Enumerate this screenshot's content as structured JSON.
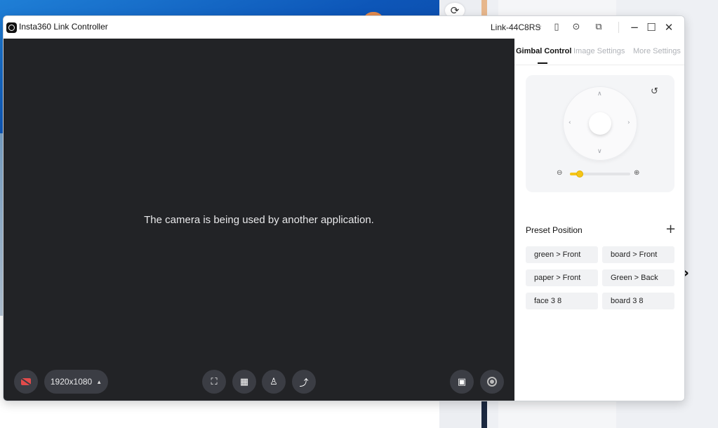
{
  "window": {
    "app_title": "Insta360 Link Controller",
    "device_name": "Link-44C8RS",
    "icons": [
      "device-icon",
      "more-icon",
      "pip-icon",
      "minimize-icon",
      "maximize-icon",
      "close-icon"
    ]
  },
  "preview": {
    "message": "The camera is being used by another application.",
    "resolution": "1920x1080",
    "bottom_icons": [
      "camera-off-icon",
      "tracking-icon",
      "whiteboard-icon",
      "desk-view-icon",
      "overhead-icon",
      "snapshot-icon",
      "record-icon"
    ]
  },
  "panel": {
    "tabs": [
      {
        "label": "Gimbal Control",
        "active": true
      },
      {
        "label": "Image Settings",
        "active": false
      },
      {
        "label": "More Settings",
        "active": false
      }
    ],
    "zoom_level": 0.12,
    "preset_title": "Preset Position",
    "presets": [
      "green > Front",
      "board > Front",
      "paper > Front",
      "Green > Back",
      "face 3 8",
      "board 3 8"
    ]
  },
  "colors": {
    "accent": "#f5c518",
    "preview_bg": "#222326",
    "camera_off": "#e34b4b"
  }
}
